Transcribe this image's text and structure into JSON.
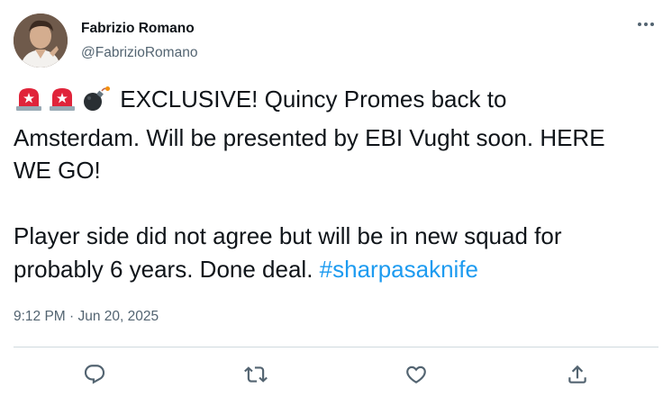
{
  "author": {
    "name": "Fabrizio Romano",
    "handle": "@FabrizioRomano"
  },
  "tweet": {
    "emojis": [
      "police-siren-emoji",
      "police-siren-emoji",
      "bomb-emoji"
    ],
    "text_line1": "EXCLUSIVE! Quincy Promes back to",
    "text_line2": "Amsterdam. Will be presented by EBI Vught soon. HERE",
    "text_line3": "WE GO!",
    "text_line4": "Player side did not agree but will be in new squad for",
    "text_line5": "probably 6 years. Done deal. ",
    "hashtag": "#sharpasaknife",
    "timestamp": "9:12 PM · Jun 20, 2025"
  },
  "actions": [
    "reply-icon",
    "retweet-icon",
    "like-icon",
    "share-icon"
  ],
  "colors": {
    "text": "#0f1419",
    "secondary": "#536471",
    "link": "#1d9bf0",
    "divider": "#cfd9de"
  }
}
